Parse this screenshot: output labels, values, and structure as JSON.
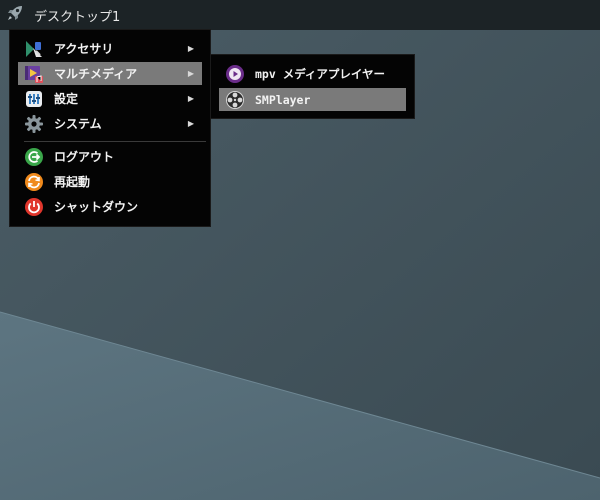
{
  "panel": {
    "title": "デスクトップ1",
    "launcher_icon": "rocket-icon"
  },
  "main_menu": {
    "items": [
      {
        "label": "アクセサリ",
        "icon": "accessories-icon",
        "has_submenu": true
      },
      {
        "label": "マルチメディア",
        "icon": "multimedia-icon",
        "has_submenu": true,
        "active": true
      },
      {
        "label": "設定",
        "icon": "settings-icon",
        "has_submenu": true
      },
      {
        "label": "システム",
        "icon": "system-gear-icon",
        "has_submenu": true
      },
      {
        "label": "ログアウト",
        "icon": "logout-icon",
        "has_submenu": false
      },
      {
        "label": "再起動",
        "icon": "restart-icon",
        "has_submenu": false
      },
      {
        "label": "シャットダウン",
        "icon": "shutdown-icon",
        "has_submenu": false
      }
    ],
    "arrow": "▶"
  },
  "sub_menu": {
    "items": [
      {
        "label": "mpv メディアプレイヤー",
        "icon": "mpv-icon"
      },
      {
        "label": "SMPlayer",
        "icon": "smplayer-icon",
        "active": true
      }
    ]
  },
  "colors": {
    "panel_bg": "#1c2326",
    "menu_bg": "#040404",
    "highlight": "#7a7a7a",
    "wallpaper_dark": "#3d4d55",
    "wallpaper_light": "#5a717d",
    "logout_green": "#3aa64a",
    "restart_orange": "#f08a1c",
    "shutdown_red": "#e0362c",
    "mpv_purple": "#6b2d8a"
  }
}
